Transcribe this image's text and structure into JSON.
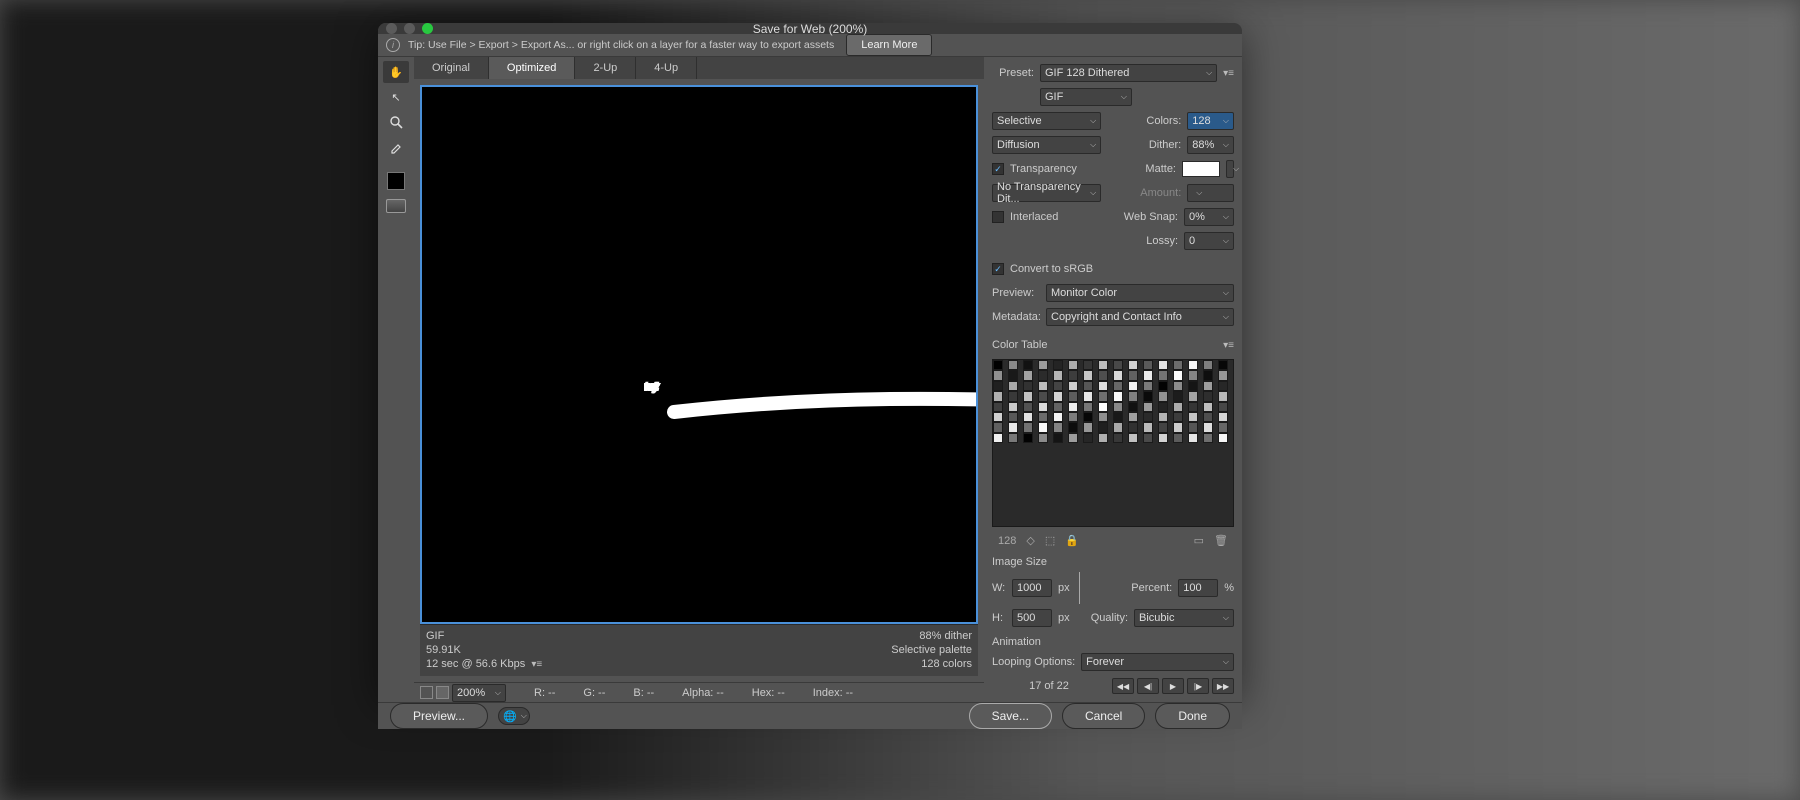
{
  "window": {
    "title": "Save for Web (200%)"
  },
  "tip": {
    "text": "Tip: Use File > Export > Export As...   or right click on a layer for a faster way to export assets",
    "learn_more": "Learn More"
  },
  "tabs": [
    "Original",
    "Optimized",
    "2-Up",
    "4-Up"
  ],
  "tabs_active": 1,
  "preview_info": {
    "left": [
      "GIF",
      "59.91K",
      "12 sec @ 56.6 Kbps"
    ],
    "right": [
      "88% dither",
      "Selective palette",
      "128 colors"
    ]
  },
  "readout": {
    "zoom": "200%",
    "r": "R: --",
    "g": "G: --",
    "b": "B: --",
    "alpha": "Alpha: --",
    "hex": "Hex: --",
    "index": "Index: --"
  },
  "settings": {
    "preset_label": "Preset:",
    "preset_value": "GIF 128 Dithered",
    "format_value": "GIF",
    "reduction_value": "Selective",
    "colors_label": "Colors:",
    "colors_value": "128",
    "dither_alg": "Diffusion",
    "dither_label": "Dither:",
    "dither_value": "88%",
    "transparency_label": "Transparency",
    "transparency_checked": true,
    "matte_label": "Matte:",
    "transp_dither_value": "No Transparency Dit...",
    "amount_label": "Amount:",
    "interlaced_label": "Interlaced",
    "interlaced_checked": false,
    "websnap_label": "Web Snap:",
    "websnap_value": "0%",
    "lossy_label": "Lossy:",
    "lossy_value": "0",
    "srgb_label": "Convert to sRGB",
    "srgb_checked": true,
    "preview_label": "Preview:",
    "preview_value": "Monitor Color",
    "metadata_label": "Metadata:",
    "metadata_value": "Copyright and Contact Info"
  },
  "color_table": {
    "title": "Color Table",
    "count": "128"
  },
  "image_size": {
    "title": "Image Size",
    "w_label": "W:",
    "w_value": "1000",
    "px": "px",
    "h_label": "H:",
    "h_value": "500",
    "percent_label": "Percent:",
    "percent_value": "100",
    "pct_sym": "%",
    "quality_label": "Quality:",
    "quality_value": "Bicubic"
  },
  "animation": {
    "title": "Animation",
    "loop_label": "Looping Options:",
    "loop_value": "Forever",
    "frame_text": "17 of 22"
  },
  "footer": {
    "preview": "Preview...",
    "save": "Save...",
    "cancel": "Cancel",
    "done": "Done"
  }
}
